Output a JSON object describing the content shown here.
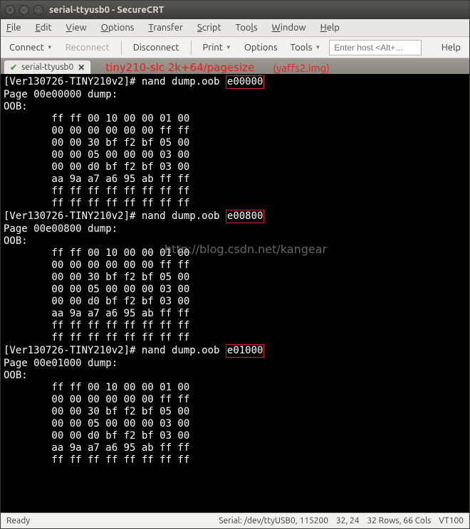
{
  "window": {
    "title": "serial-ttyusb0 - SecureCRT"
  },
  "menu": {
    "file": "File",
    "edit": "Edit",
    "view": "View",
    "options": "Options",
    "transfer": "Transfer",
    "script": "Script",
    "tools": "Tools",
    "window": "Window",
    "help": "Help"
  },
  "toolbar": {
    "connect": "Connect",
    "reconnect": "Reconnect",
    "disconnect": "Disconnect",
    "print": "Print",
    "options": "Options",
    "tools": "Tools",
    "host_placeholder": "Enter host <Alt+...",
    "help": "Help"
  },
  "tab": {
    "name": "serial-ttyusb0",
    "annot1": "tiny210-slc  2k+64/pagesize",
    "annot2": "(yaffs2.img)"
  },
  "term": {
    "prompt": "[Ver130726-TINY210v2]# ",
    "cmd": "nand dump.oob ",
    "addr1": "e00000",
    "addr2": "e00800",
    "addr3": "e01000",
    "page1": "Page 00e00000 dump:",
    "page2": "Page 00e00800 dump:",
    "page3": "Page 00e01000 dump:",
    "oob": "OOB:",
    "rows_full": [
      "        ff ff 00 10 00 00 01 00",
      "        00 00 00 00 00 00 ff ff",
      "        00 00 30 bf f2 bf 05 00",
      "        00 00 05 00 00 00 03 00",
      "        00 00 d0 bf f2 bf 03 00",
      "        aa 9a a7 a6 95 ab ff ff",
      "        ff ff ff ff ff ff ff ff",
      "        ff ff ff ff ff ff ff ff"
    ],
    "rows_partial": [
      "        ff ff 00 10 00 00 01 00",
      "        00 00 00 00 00 00 ff ff",
      "        00 00 30 bf f2 bf 05 00",
      "        00 00 05 00 00 00 03 00",
      "        00 00 d0 bf f2 bf 03 00",
      "        aa 9a a7 a6 95 ab ff ff",
      "        ff ff ff ff ff ff ff ff"
    ]
  },
  "watermark": "http://blog.csdn.net/kangear",
  "status": {
    "ready": "Ready",
    "serial": "Serial: /dev/ttyUSB0, 115200",
    "pos": "32, 24",
    "dim": "32 Rows, 66 Cols",
    "emul": "VT100"
  }
}
